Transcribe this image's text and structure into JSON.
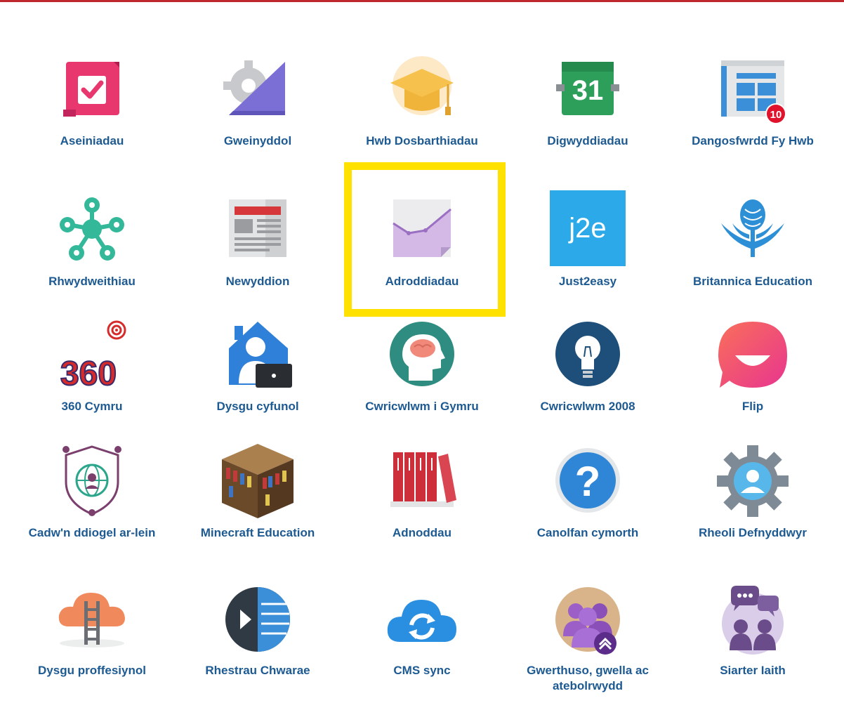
{
  "colors": {
    "label": "#1d5a92",
    "top_border": "#c0272d",
    "highlight": "#ffe100"
  },
  "tiles": [
    {
      "label": "Aseiniadau",
      "icon": "assignments-icon"
    },
    {
      "label": "Gweinyddol",
      "icon": "admin-gear-icon"
    },
    {
      "label": "Hwb Dosbarthiadau",
      "icon": "graduation-cap-icon"
    },
    {
      "label": "Digwyddiadau",
      "icon": "calendar-31-icon",
      "icon_text": "31"
    },
    {
      "label": "Dangosfwrdd Fy Hwb",
      "icon": "dashboard-icon",
      "badge": "10"
    },
    {
      "label": "Rhwydweithiau",
      "icon": "network-icon"
    },
    {
      "label": "Newyddion",
      "icon": "newspaper-icon"
    },
    {
      "label": "Adroddiadau",
      "icon": "reports-chart-icon"
    },
    {
      "label": "Just2easy",
      "icon": "j2e-icon",
      "icon_text": "j2e"
    },
    {
      "label": "Britannica Education",
      "icon": "britannica-thistle-icon"
    },
    {
      "label": "360 Cymru",
      "icon": "360-cymru-icon",
      "icon_text": "360"
    },
    {
      "label": "Dysgu cyfunol",
      "icon": "blended-learning-icon"
    },
    {
      "label": "Cwricwlwm i Gymru",
      "icon": "brain-head-icon"
    },
    {
      "label": "Cwricwlwm 2008",
      "icon": "lightbulb-icon"
    },
    {
      "label": "Flip",
      "icon": "flip-icon"
    },
    {
      "label": "Cadw'n ddiogel ar-lein",
      "icon": "online-safety-icon"
    },
    {
      "label": "Minecraft Education",
      "icon": "minecraft-bookshelf-icon"
    },
    {
      "label": "Adnoddau",
      "icon": "resources-books-icon"
    },
    {
      "label": "Canolfan cymorth",
      "icon": "help-question-icon",
      "icon_text": "?"
    },
    {
      "label": "Rheoli Defnyddwyr",
      "icon": "user-management-gear-icon"
    },
    {
      "label": "Dysgu proffesiynol",
      "icon": "professional-learning-cloud-icon"
    },
    {
      "label": "Rhestrau Chwarae",
      "icon": "playlists-icon"
    },
    {
      "label": "CMS sync",
      "icon": "cms-sync-cloud-icon"
    },
    {
      "label": "Gwerthuso, gwella ac atebolrwydd",
      "icon": "evaluation-people-icon"
    },
    {
      "label": "Siarter Iaith",
      "icon": "language-charter-icon"
    }
  ]
}
